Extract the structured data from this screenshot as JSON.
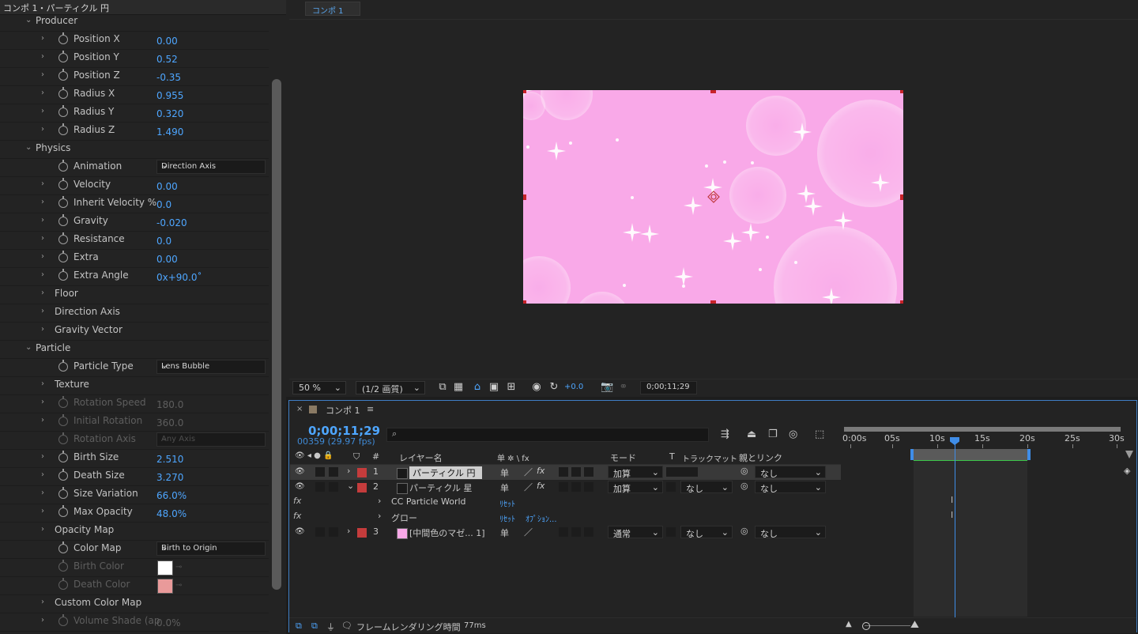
{
  "effect_panel": {
    "title": "コンポ 1・パーティクル 円",
    "rows": [
      {
        "label": "Producer",
        "value": "",
        "indent": 0,
        "expanded": true,
        "stopwatch": false,
        "kind": "group"
      },
      {
        "label": "Position X",
        "value": "0.00",
        "indent": 1,
        "kind": "value"
      },
      {
        "label": "Position Y",
        "value": "0.52",
        "indent": 1,
        "kind": "value"
      },
      {
        "label": "Position Z",
        "value": "-0.35",
        "indent": 1,
        "kind": "value"
      },
      {
        "label": "Radius X",
        "value": "0.955",
        "indent": 1,
        "kind": "value"
      },
      {
        "label": "Radius Y",
        "value": "0.320",
        "indent": 1,
        "kind": "value"
      },
      {
        "label": "Radius Z",
        "value": "1.490",
        "indent": 1,
        "kind": "value"
      },
      {
        "label": "Physics",
        "value": "",
        "indent": 0,
        "expanded": true,
        "kind": "group"
      },
      {
        "label": "Animation",
        "value": "Direction Axis",
        "indent": 1,
        "kind": "dropdown",
        "nochev": true
      },
      {
        "label": "Velocity",
        "value": "0.00",
        "indent": 1,
        "kind": "value"
      },
      {
        "label": "Inherit Velocity %",
        "value": "0.0",
        "indent": 1,
        "kind": "value"
      },
      {
        "label": "Gravity",
        "value": "-0.020",
        "indent": 1,
        "kind": "value"
      },
      {
        "label": "Resistance",
        "value": "0.0",
        "indent": 1,
        "kind": "value"
      },
      {
        "label": "Extra",
        "value": "0.00",
        "indent": 1,
        "kind": "value"
      },
      {
        "label": "Extra Angle",
        "value": "0x+90.0˚",
        "indent": 1,
        "kind": "value"
      },
      {
        "label": "Floor",
        "value": "",
        "indent": 1,
        "kind": "subgroup"
      },
      {
        "label": "Direction Axis",
        "value": "",
        "indent": 1,
        "kind": "subgroup"
      },
      {
        "label": "Gravity Vector",
        "value": "",
        "indent": 1,
        "kind": "subgroup"
      },
      {
        "label": "Particle",
        "value": "",
        "indent": 0,
        "expanded": true,
        "kind": "group"
      },
      {
        "label": "Particle Type",
        "value": "Lens Bubble",
        "indent": 1,
        "kind": "dropdown",
        "nochev": true
      },
      {
        "label": "Texture",
        "value": "",
        "indent": 1,
        "kind": "subgroup"
      },
      {
        "label": "Rotation Speed",
        "value": "180.0",
        "indent": 1,
        "kind": "value",
        "dim": true
      },
      {
        "label": "Initial Rotation",
        "value": "360.0",
        "indent": 1,
        "kind": "value",
        "dim": true
      },
      {
        "label": "Rotation Axis",
        "value": "Any Axis",
        "indent": 1,
        "kind": "dropdown",
        "nochev": true,
        "dim": true
      },
      {
        "label": "Birth Size",
        "value": "2.510",
        "indent": 1,
        "kind": "value"
      },
      {
        "label": "Death Size",
        "value": "3.270",
        "indent": 1,
        "kind": "value"
      },
      {
        "label": "Size Variation",
        "value": "66.0%",
        "indent": 1,
        "kind": "value"
      },
      {
        "label": "Max Opacity",
        "value": "48.0%",
        "indent": 1,
        "kind": "value"
      },
      {
        "label": "Opacity Map",
        "value": "",
        "indent": 1,
        "kind": "subgroup"
      },
      {
        "label": "Color Map",
        "value": "Birth to Origin",
        "indent": 1,
        "kind": "dropdown",
        "nochev": true
      },
      {
        "label": "Birth Color",
        "value": "#ffffff",
        "indent": 1,
        "kind": "color",
        "nochev": true,
        "dim": true
      },
      {
        "label": "Death Color",
        "value": "#e99a9a",
        "indent": 1,
        "kind": "color",
        "nochev": true,
        "dim": true
      },
      {
        "label": "Custom Color Map",
        "value": "",
        "indent": 1,
        "kind": "subgroup"
      },
      {
        "label": "Volume Shade (ap",
        "value": "0.0%",
        "indent": 1,
        "kind": "value",
        "dim": true
      }
    ]
  },
  "viewer": {
    "tab_label": "コンポ 1",
    "zoom": "50 %",
    "quality": "(1/2 画質)",
    "exposure": "+0.0",
    "timecode": "0;00;11;29",
    "canvas_color": "#f9a9e8"
  },
  "timeline": {
    "tab_label": "コンポ 1",
    "timecode": "0;00;11;29",
    "frames_fps": "00359 (29.97 fps)",
    "search_placeholder": "",
    "columns": {
      "layer_name": "レイヤー名",
      "switches": "单 ✲ \\ fx",
      "mode": "モード",
      "t": "T",
      "track_matte": "トラックマット",
      "parent": "親とリンク",
      "num": "#"
    },
    "ruler": [
      "0:00s",
      "05s",
      "10s",
      "15s",
      "20s",
      "25s",
      "30s"
    ],
    "layers": [
      {
        "num": "1",
        "name": "パーティクル 円",
        "color": "#c43c3c",
        "mode": "加算",
        "matte": "",
        "parent": "なし",
        "selected": true,
        "bar": true,
        "expanded": false
      },
      {
        "num": "2",
        "name": "パーティクル 星",
        "color": "#c43c3c",
        "mode": "加算",
        "matte": "なし",
        "parent": "なし",
        "selected": false,
        "bar": true,
        "expanded": true
      }
    ],
    "effects": [
      {
        "name": "CC Particle World",
        "reset": "ﾘｾｯﾄ",
        "options": ""
      },
      {
        "name": "グロー",
        "reset": "ﾘｾｯﾄ",
        "options": "ｵﾌﾟｼｮﾝ..."
      }
    ],
    "layer3": {
      "num": "3",
      "name": "[中間色のマゼ... 1]",
      "color": "#c43c3c",
      "swatch": "#f9a9e8",
      "mode": "通常",
      "matte": "なし",
      "parent": "なし"
    },
    "footer_label": "フレームレンダリング時間",
    "footer_value": "77ms"
  }
}
